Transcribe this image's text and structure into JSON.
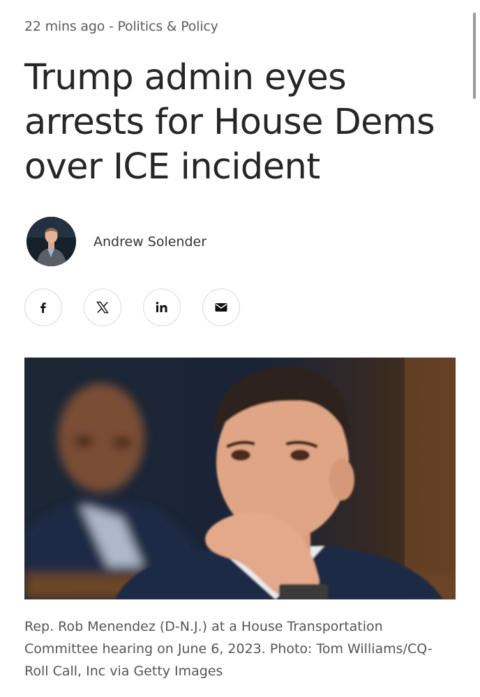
{
  "article": {
    "timestamp": "22 mins ago",
    "separator": " - ",
    "category": "Politics & Policy",
    "headline": "Trump admin eyes arrests for House Dems over ICE incident",
    "author": {
      "name": "Andrew Solender"
    },
    "share": [
      {
        "name": "facebook",
        "icon": "facebook-icon"
      },
      {
        "name": "x",
        "icon": "x-icon"
      },
      {
        "name": "linkedin",
        "icon": "linkedin-icon"
      },
      {
        "name": "email",
        "icon": "email-icon"
      }
    ],
    "photo": {
      "caption": "Rep. Rob Menendez (D-N.J.) at a House Transportation Committee hearing on June 6, 2023. Photo: Tom Williams/CQ-Roll Call, Inc via Getty Images"
    }
  },
  "colors": {
    "text": "#262626",
    "meta": "#5c5c5c",
    "border": "#dadada"
  }
}
